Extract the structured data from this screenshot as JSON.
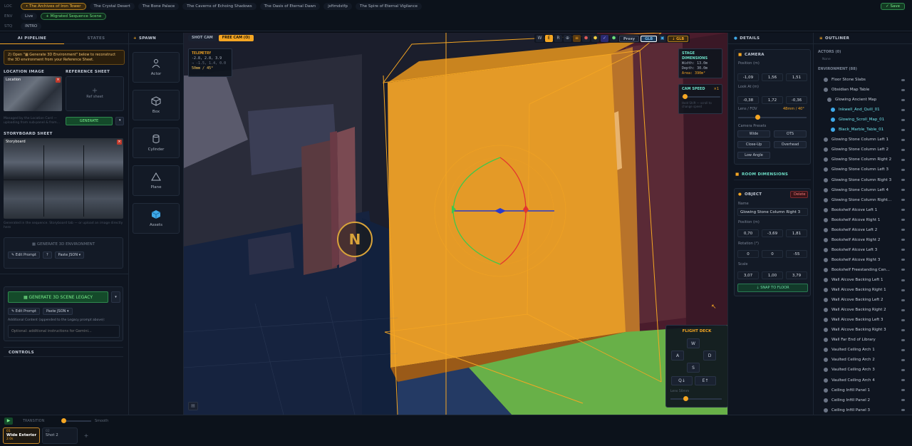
{
  "topbar": {
    "loc_label": "LOC",
    "env_label": "ENV",
    "stq_label": "STQ",
    "loc_chips": [
      "• The Archives of Iron Tower",
      "The Crystal Desert",
      "The Bone Palace",
      "The Caverns of Echoing Shadows",
      "The Oasis of Eternal Dawn",
      "jsftmdstfp",
      "The Spire of Eternal Vigilance"
    ],
    "env_chips": [
      "Live",
      "+ Migrated Sequence Scene"
    ],
    "stq_chips": [
      "INTRO"
    ],
    "save": "✓ Save"
  },
  "left": {
    "tab_pipeline": "AI PIPELINE",
    "tab_states": "STATES",
    "notice": "2) Open \"▦ Generate 3D Environment\" below to reconstruct the 3D environment from your Reference Sheet.",
    "location_image": "LOCATION IMAGE",
    "reference_sheet": "REFERENCE SHEET",
    "location_thumb_label": "Location",
    "ref_plus": "+",
    "ref_sub": "Ref sheet",
    "managed_note": "Managed by the Location Card — uploading from sub-panel & from...",
    "generate": "GENERATE",
    "storyboard_sheet": "STORYBOARD SHEET",
    "storyboard_label": "Storyboard",
    "storyboard_note": "Generated in the sequence. Storyboard tab — or upload an image directly here",
    "gen3d": "▦ GENERATE 3D ENVIRONMENT",
    "edit_prompt": "✎ Edit Prompt",
    "q": "?",
    "paste_json": "Paste JSON ▾",
    "legacy": "▦ GENERATE 3D SCENE LEGACY",
    "legacy_caret": "▾",
    "edit_prompt2": "✎ Edit Prompt",
    "paste_json2": "Paste JSON ▾",
    "additional": "Additional Content (appended to the Legacy prompt above):",
    "optional_placeholder": "Optional: additional instructions for Gemini...",
    "controls": "CONTROLS"
  },
  "spawn": {
    "title": "SPAWN",
    "items": [
      "Actor",
      "Box",
      "Cylinder",
      "Plane",
      "Assets"
    ]
  },
  "viewport": {
    "shot_cam": "SHOT CAM",
    "free_cam": "FREE CAM (O)",
    "telemetry_title": "TELEMETRY",
    "telemetry_lines": [
      "-2.8, 2.8, 3.9",
      "→ -1.5, 1.4, 0.0",
      "50mm / 45°"
    ],
    "toolbar": [
      "W",
      "E",
      "R",
      "⊕",
      "≡",
      "⬢",
      "⬢",
      "✓",
      "⬢"
    ],
    "proxy": "Proxy",
    "glb": "GLB",
    "glb_btn": "↓ GLB",
    "stage_title": "STAGE DIMENSIONS",
    "stage_width": "Width: 13.0m",
    "stage_depth": "Depth: 30.0m",
    "stage_area": "Area: 390m²",
    "cam_speed": "CAM SPEED",
    "cam_speed_val": "×1",
    "cam_speed_note": "Hold Shift — scroll to change speed",
    "compass": "N",
    "flight_title": "FLIGHT DECK",
    "keys": [
      "W",
      "A",
      "D",
      "S",
      "Q↓",
      "E↑"
    ],
    "lens_label": "Lens 50mm"
  },
  "details": {
    "title": "DETAILS",
    "camera": "CAMERA",
    "position_label": "Position (m)",
    "position": [
      "-1,09",
      "1,56",
      "1,51"
    ],
    "look_label": "Look At (m)",
    "look": [
      "-0,38",
      "1,72",
      "-0,36"
    ],
    "lens_label": "Lens / FOV",
    "lens_val": "48mm / 40°",
    "presets_label": "Camera Presets",
    "presets": [
      "Wide",
      "OTS",
      "Close-Up",
      "Overhead",
      "Low Angle"
    ],
    "room_dims": "ROOM DIMENSIONS",
    "object": "OBJECT",
    "delete": "Delete",
    "name_label": "Name",
    "name": "Glowing Stone Column Right 3",
    "opos_label": "Position (m)",
    "opos": [
      "0,70",
      "-3,69",
      "1,81"
    ],
    "rot_label": "Rotation (°)",
    "rot": [
      "0",
      "0",
      "-55"
    ],
    "scale_label": "Scale",
    "scale": [
      "3,07",
      "1,00",
      "3,79"
    ],
    "snap": "⇣ SNAP TO FLOOR"
  },
  "outliner": {
    "title": "OUTLINER",
    "actors": "ACTORS (0)",
    "none": "None",
    "environment": "ENVIRONMENT (88)",
    "items": [
      "Floor Stone Slabs",
      "Obsidian Map Table",
      "Glowing Ancient Map",
      "Inkwell_And_Quill_01",
      "Glowing_Scroll_Map_01",
      "Black_Marble_Table_01",
      "Glowing Stone Column Left 1",
      "Glowing Stone Column Left 2",
      "Glowing Stone Column Right 2",
      "Glowing Stone Column Left 3",
      "Glowing Stone Column Right 3",
      "Glowing Stone Column Left 4",
      "Glowing Stone Column Right...",
      "Bookshelf Alcove Left 1",
      "Bookshelf Alcove Right 1",
      "Bookshelf Alcove Left 2",
      "Bookshelf Alcove Right 2",
      "Bookshelf Alcove Left 3",
      "Bookshelf Alcove Right 3",
      "Bookshelf Freestanding Cen...",
      "Wall Alcove Backing Left 1",
      "Wall Alcove Backing Right 1",
      "Wall Alcove Backing Left 2",
      "Wall Alcove Backing Right 2",
      "Wall Alcove Backing Left 3",
      "Wall Alcove Backing Right 3",
      "Wall Far End of Library",
      "Vaulted Ceiling Arch 1",
      "Vaulted Ceiling Arch 2",
      "Vaulted Ceiling Arch 3",
      "Vaulted Ceiling Arch 4",
      "Ceiling Infill Panel 1",
      "Ceiling Infill Panel 2",
      "Ceiling Infill Panel 3"
    ]
  },
  "timeline": {
    "transition": "TRANSITION",
    "smooth": "Smooth",
    "shot1_num": "01",
    "shot1": "Wide Exterior ...",
    "shot1_dur": "2.0s",
    "shot2_num": "02",
    "shot2": "Shot 2",
    "add": "+"
  },
  "colors": {
    "accent": "#f5a623",
    "green": "#6ee07a",
    "selection": "#f5a623"
  }
}
